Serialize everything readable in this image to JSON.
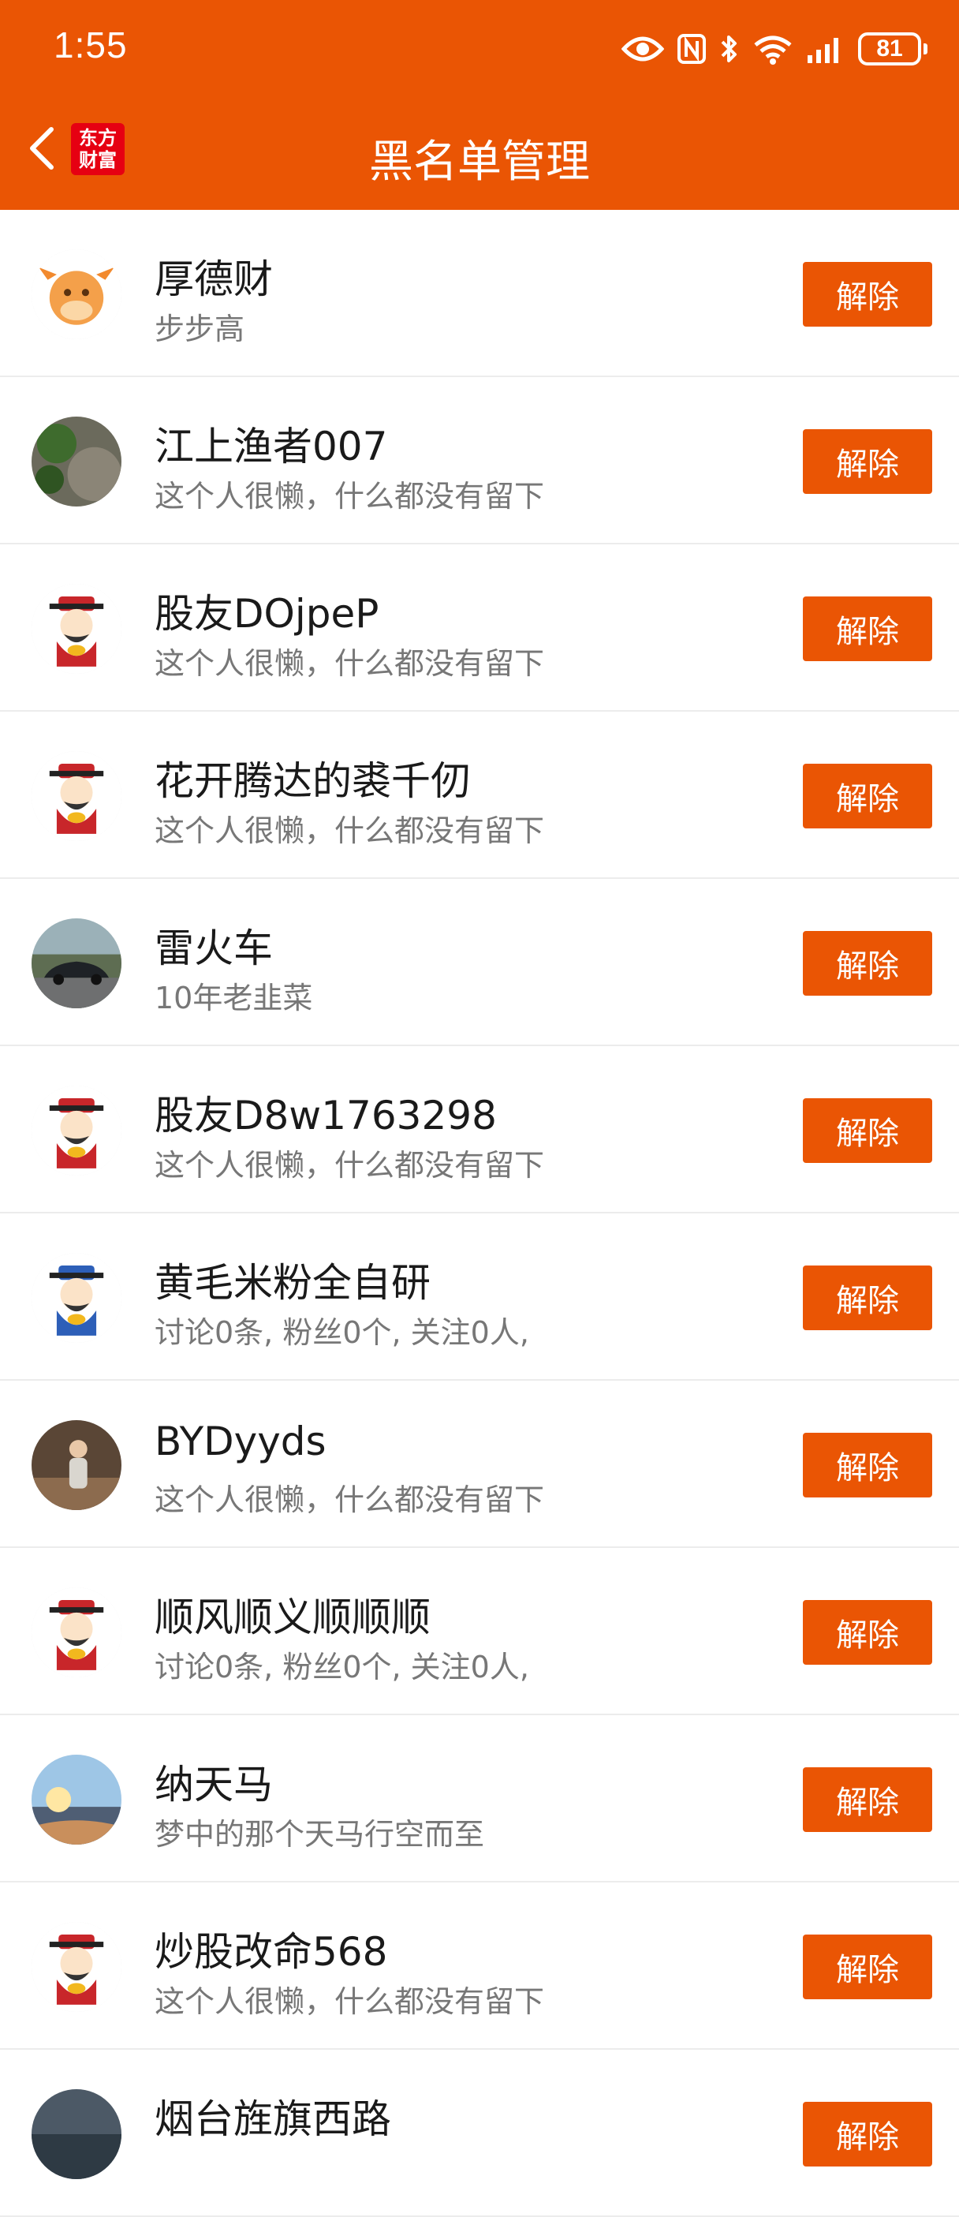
{
  "colors": {
    "accent": "#EA5504",
    "logo_red": "#E60012"
  },
  "status_bar": {
    "time": "1:55",
    "icons": [
      "eye-icon",
      "nfc-icon",
      "bluetooth-icon",
      "wifi-icon",
      "signal-icon",
      "battery-icon"
    ],
    "battery": "81"
  },
  "header": {
    "title": "黑名单管理",
    "back_icon": "chevron-left-icon",
    "logo_line1": "东方",
    "logo_line2": "财富"
  },
  "unblock_label": "解除",
  "users": [
    {
      "name": "厚德财",
      "subtitle": "步步高",
      "avatar": "cow"
    },
    {
      "name": "江上渔者007",
      "subtitle": "这个人很懒，什么都没有留下",
      "avatar": "photo-plant"
    },
    {
      "name": "股友DOjpeP",
      "subtitle": "这个人很懒，什么都没有留下",
      "avatar": "caishen"
    },
    {
      "name": "花开腾达的裘千仞",
      "subtitle": "这个人很懒，什么都没有留下",
      "avatar": "caishen"
    },
    {
      "name": "雷火车",
      "subtitle": "10年老韭菜",
      "avatar": "photo-car"
    },
    {
      "name": "股友D8w1763298",
      "subtitle": "这个人很懒，什么都没有留下",
      "avatar": "caishen"
    },
    {
      "name": "黄毛米粉全自研",
      "subtitle": "讨论0条, 粉丝0个, 关注0人,",
      "avatar": "caishen-blue"
    },
    {
      "name": "BYDyyds",
      "subtitle": "这个人很懒，什么都没有留下",
      "avatar": "photo-person"
    },
    {
      "name": "顺风顺义顺顺顺",
      "subtitle": "讨论0条, 粉丝0个, 关注0人,",
      "avatar": "caishen"
    },
    {
      "name": "纳天马",
      "subtitle": "梦中的那个天马行空而至",
      "avatar": "photo-sunset"
    },
    {
      "name": "炒股改命568",
      "subtitle": "这个人很懒，什么都没有留下",
      "avatar": "caishen"
    },
    {
      "name": "烟台旌旗西路",
      "subtitle": "",
      "avatar": "photo-dark"
    }
  ]
}
